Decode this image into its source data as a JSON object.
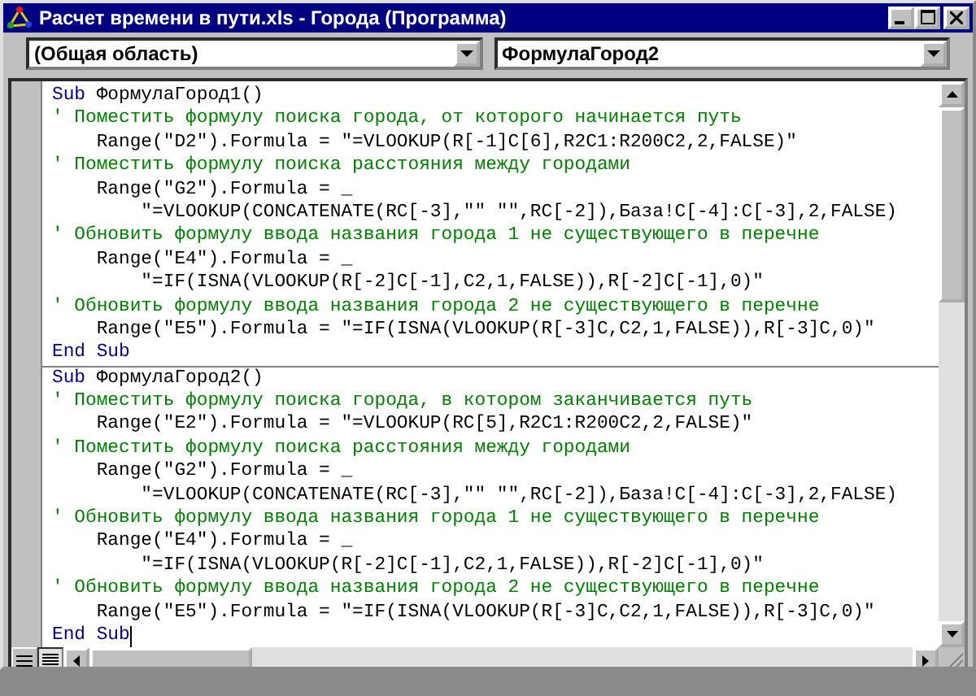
{
  "window": {
    "title": "Расчет времени в пути.xls - Города (Программа)"
  },
  "object_box": {
    "value": "(Общая область)"
  },
  "procedure_box": {
    "value": "ФормулаГород2"
  },
  "procedures": [
    {
      "lines": [
        {
          "kind": "sub_start",
          "keyword": "Sub",
          "text": "ФормулаГород1()"
        },
        {
          "kind": "comment",
          "text": "' Поместить формулу поиска города, от которого начинается путь"
        },
        {
          "kind": "code",
          "text": "    Range(\"D2\").Formula = \"=VLOOKUP(R[-1]C[6],R2C1:R200C2,2,FALSE)\""
        },
        {
          "kind": "comment",
          "text": "' Поместить формулу поиска расстояния между городами"
        },
        {
          "kind": "code",
          "text": "    Range(\"G2\").Formula = _"
        },
        {
          "kind": "code",
          "text": "        \"=VLOOKUP(CONCATENATE(RC[-3],\"\" \"\",RC[-2]),База!C[-4]:C[-3],2,FALSE)"
        },
        {
          "kind": "comment",
          "text": "' Обновить формулу ввода названия города 1 не существующего в перечне"
        },
        {
          "kind": "code",
          "text": "    Range(\"E4\").Formula = _"
        },
        {
          "kind": "code",
          "text": "        \"=IF(ISNA(VLOOKUP(R[-2]C[-1],C2,1,FALSE)),R[-2]C[-1],0)\""
        },
        {
          "kind": "comment",
          "text": "' Обновить формулу ввода названия города 2 не существующего в перечне"
        },
        {
          "kind": "code",
          "text": "    Range(\"E5\").Formula = \"=IF(ISNA(VLOOKUP(R[-3]C,C2,1,FALSE)),R[-3]C,0)\""
        },
        {
          "kind": "sub_end",
          "text": "End Sub"
        }
      ]
    },
    {
      "lines": [
        {
          "kind": "sub_start",
          "keyword": "Sub",
          "text": "ФормулаГород2()"
        },
        {
          "kind": "comment",
          "text": "' Поместить формулу поиска города, в котором заканчивается путь"
        },
        {
          "kind": "code",
          "text": "    Range(\"E2\").Formula = \"=VLOOKUP(RC[5],R2C1:R200C2,2,FALSE)\""
        },
        {
          "kind": "comment",
          "text": "' Поместить формулу поиска расстояния между городами"
        },
        {
          "kind": "code",
          "text": "    Range(\"G2\").Formula = _"
        },
        {
          "kind": "code",
          "text": "        \"=VLOOKUP(CONCATENATE(RC[-3],\"\" \"\",RC[-2]),База!C[-4]:C[-3],2,FALSE)"
        },
        {
          "kind": "comment",
          "text": "' Обновить формулу ввода названия города 1 не существующего в перечне"
        },
        {
          "kind": "code",
          "text": "    Range(\"E4\").Formula = _"
        },
        {
          "kind": "code",
          "text": "        \"=IF(ISNA(VLOOKUP(R[-2]C[-1],C2,1,FALSE)),R[-2]C[-1],0)\""
        },
        {
          "kind": "comment",
          "text": "' Обновить формулу ввода названия города 2 не существующего в перечне"
        },
        {
          "kind": "code",
          "text": "    Range(\"E5\").Formula = \"=IF(ISNA(VLOOKUP(R[-3]C,C2,1,FALSE)),R[-3]C,0)\""
        },
        {
          "kind": "sub_end",
          "text": "End Sub",
          "caret": true
        }
      ]
    }
  ]
}
